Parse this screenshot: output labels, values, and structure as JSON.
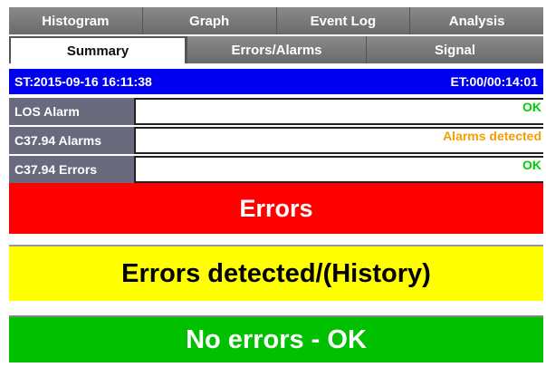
{
  "tabs_top": [
    "Histogram",
    "Graph",
    "Event Log",
    "Analysis"
  ],
  "tabs_second": {
    "active": "Summary",
    "others": [
      "Errors/Alarms",
      "Signal"
    ]
  },
  "status": {
    "start": "ST:2015-09-16 16:11:38",
    "elapsed": "ET:00/00:14:01"
  },
  "rows": [
    {
      "label": "LOS Alarm",
      "value": "OK",
      "color": "#00d000"
    },
    {
      "label": "C37.94 Alarms",
      "value": "Alarms detected",
      "color": "#f0a000"
    },
    {
      "label": "C37.94 Errors",
      "value": "OK",
      "color": "#00d000"
    }
  ],
  "banners": {
    "errors": {
      "text": "Errors",
      "bg": "#ff0000",
      "fg": "#ffffff"
    },
    "history": {
      "text": "Errors detected/(History)",
      "bg": "#ffff00",
      "fg": "#000000"
    },
    "ok": {
      "text": "No errors - OK",
      "bg": "#00c000",
      "fg": "#ffffff"
    }
  }
}
